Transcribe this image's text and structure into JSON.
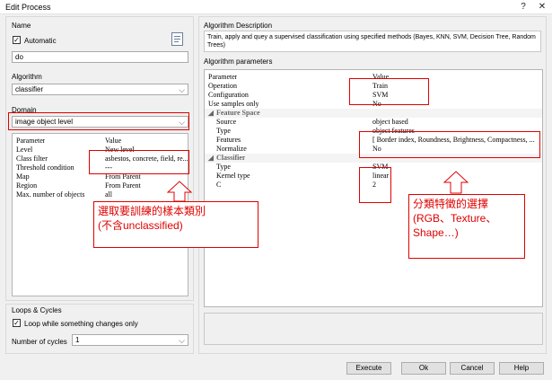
{
  "window": {
    "title": "Edit Process",
    "help_glyph": "?",
    "close_glyph": "✕"
  },
  "name_section": {
    "label": "Name",
    "automatic_label": "Automatic",
    "automatic_checked": true,
    "name_value": "do"
  },
  "algorithm_section": {
    "label": "Algorithm",
    "value": "classifier"
  },
  "domain_section": {
    "label": "Domain",
    "value": "image object level",
    "columns": [
      "Parameter",
      "Value"
    ],
    "rows": [
      {
        "name": "Level",
        "value": "New level"
      },
      {
        "name": "Class filter",
        "value": "asbestos, concrete, field, re..."
      },
      {
        "name": "Threshold condition",
        "value": "---"
      },
      {
        "name": "Map",
        "value": "From Parent"
      },
      {
        "name": "Region",
        "value": "From Parent"
      },
      {
        "name": "Max. number of objects",
        "value": "all"
      }
    ]
  },
  "loops_section": {
    "label": "Loops & Cycles",
    "loop_label": "Loop while something changes only",
    "loop_checked": true,
    "cycles_label": "Number of cycles",
    "cycles_value": "1"
  },
  "description_section": {
    "label": "Algorithm Description",
    "text": "Train, apply and quey a supervised classification using specified methods (Bayes, KNN, SVM, Decision Tree, Random Trees)"
  },
  "parameters_section": {
    "label": "Algorithm parameters",
    "columns": [
      "Parameter",
      "Value"
    ],
    "rows": [
      {
        "kind": "param",
        "indent": 0,
        "name": "Operation",
        "value": "Train"
      },
      {
        "kind": "param",
        "indent": 0,
        "name": "Configuration",
        "value": "SVM"
      },
      {
        "kind": "param",
        "indent": 0,
        "name": "Use samples only",
        "value": "No"
      },
      {
        "kind": "section",
        "name": "Feature Space"
      },
      {
        "kind": "param",
        "indent": 1,
        "name": "Source",
        "value": "object based"
      },
      {
        "kind": "param",
        "indent": 1,
        "name": "Type",
        "value": "object features"
      },
      {
        "kind": "param",
        "indent": 1,
        "name": "Features",
        "value": "[ Border index, Roundness, Brightness, Compactness, ..."
      },
      {
        "kind": "param",
        "indent": 1,
        "name": "Normalize",
        "value": "No"
      },
      {
        "kind": "section",
        "name": "Classifier"
      },
      {
        "kind": "param",
        "indent": 1,
        "name": "Type",
        "value": "SVM"
      },
      {
        "kind": "param",
        "indent": 1,
        "name": "Kernel type",
        "value": "linear"
      },
      {
        "kind": "param",
        "indent": 1,
        "name": "C",
        "value": "2"
      }
    ]
  },
  "annotations": {
    "left_callout": "選取要訓練的樣本類別\n(不含unclassified)",
    "right_callout": "分類特徵的選擇\n(RGB、Texture、\nShape…)",
    "color": "#e00000"
  },
  "buttons": {
    "execute": "Execute",
    "ok": "Ok",
    "cancel": "Cancel",
    "help": "Help"
  }
}
